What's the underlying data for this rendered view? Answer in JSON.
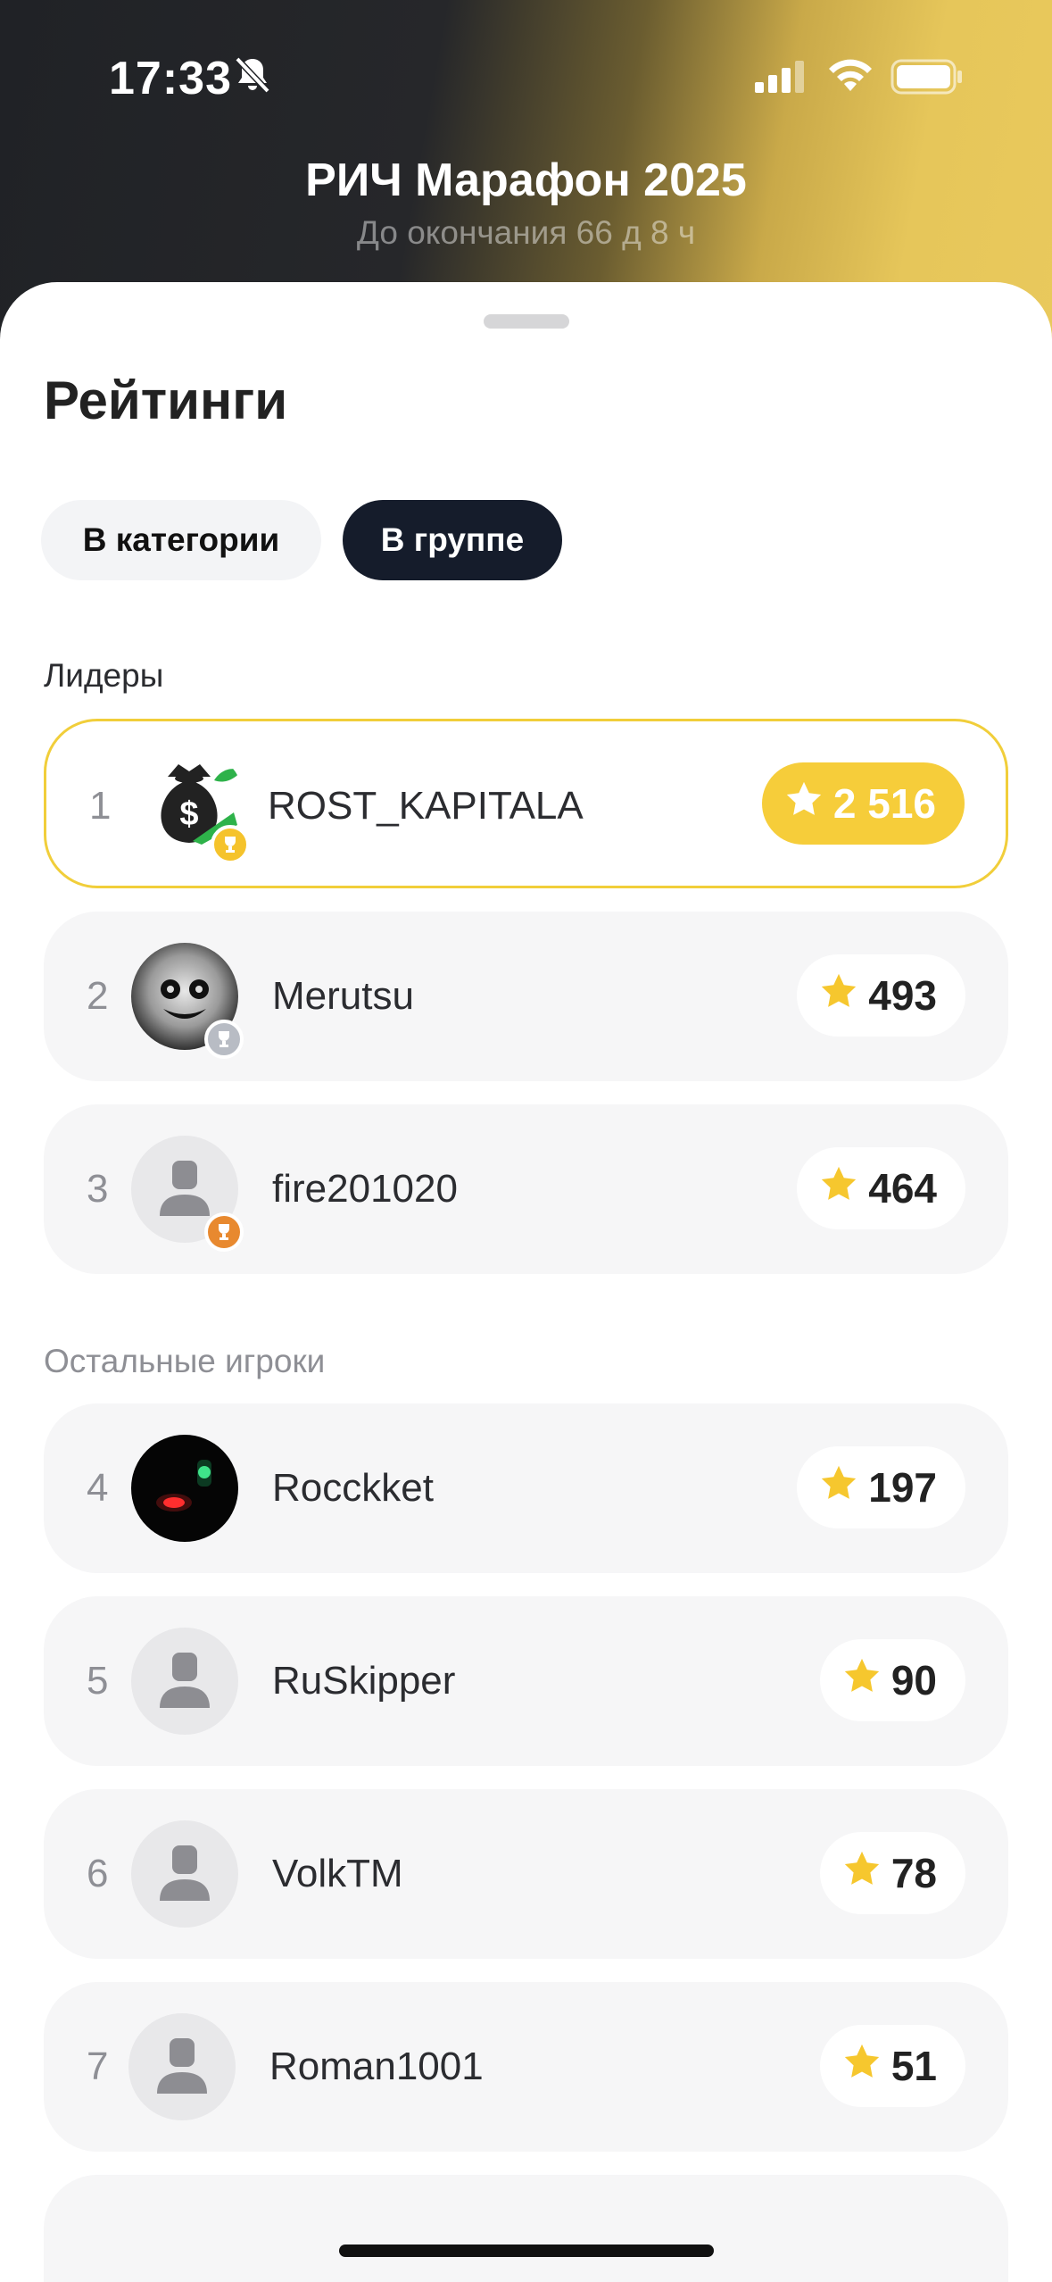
{
  "status_bar": {
    "time": "17:33"
  },
  "header": {
    "title": "РИЧ Марафон 2025",
    "subtitle": "До окончания 66 д 8 ч"
  },
  "sheet": {
    "heading": "Рейтинги",
    "tabs": [
      {
        "label": "В категории",
        "selected": false
      },
      {
        "label": "В группе",
        "selected": true
      }
    ],
    "leaders_label": "Лидеры",
    "others_label": "Остальные игроки",
    "leaders": [
      {
        "rank": "1",
        "name": "ROST_KAPITALA",
        "score": "2 516",
        "avatar": "money-bag-icon",
        "badge": "gold-trophy-icon"
      },
      {
        "rank": "2",
        "name": "Merutsu",
        "score": "493",
        "avatar": "photo",
        "badge": "silver-trophy-icon"
      },
      {
        "rank": "3",
        "name": "fire201020",
        "score": "464",
        "avatar": "default-user-icon",
        "badge": "bronze-trophy-icon"
      }
    ],
    "others": [
      {
        "rank": "4",
        "name": "Rocckket",
        "score": "197",
        "avatar": "photo"
      },
      {
        "rank": "5",
        "name": "RuSkipper",
        "score": "90",
        "avatar": "default-user-icon"
      },
      {
        "rank": "6",
        "name": "VolkTM",
        "score": "78",
        "avatar": "default-user-icon"
      },
      {
        "rank": "7",
        "name": "Roman1001",
        "score": "51",
        "avatar": "default-user-icon"
      }
    ]
  },
  "colors": {
    "accent_gold": "#f6cd3a",
    "tab_dark": "#151c2b",
    "row_bg": "#f6f6f7"
  }
}
